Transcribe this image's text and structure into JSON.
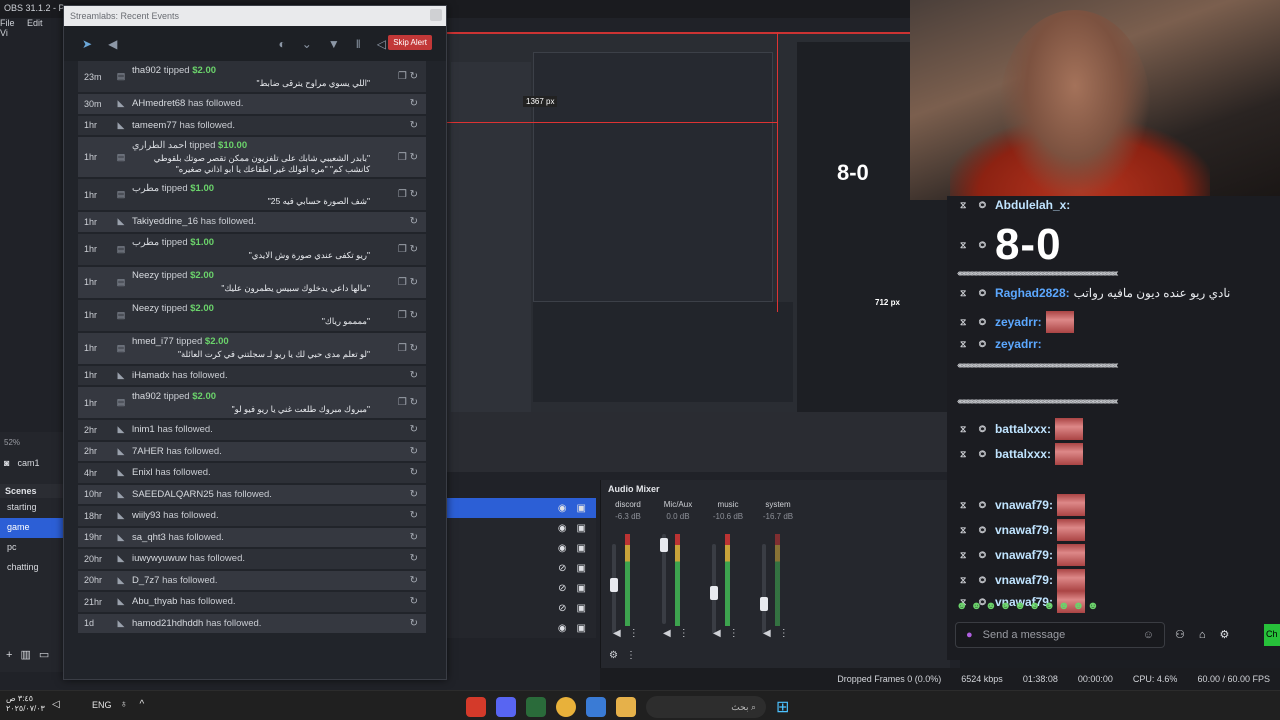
{
  "obs": {
    "title": "OBS 31.1.2 - P",
    "menu": [
      "File",
      "Edit",
      "Vi"
    ],
    "zoom": "52%",
    "cam_label": "cam1",
    "scenes_header": "Scenes",
    "scenes": [
      "starting",
      "game",
      "pc",
      "chatting"
    ],
    "active_scene": "game"
  },
  "events": {
    "title": "Streamlabs: Recent Events",
    "skip_label": "Skip Alert",
    "items": [
      {
        "time": "23m",
        "icon": "tip-icon",
        "name": "tha902",
        "action": "tipped",
        "amount": "$2.00",
        "message": "\"اللي يسوي مراوح يترقى ضابط\""
      },
      {
        "time": "30m",
        "icon": "follow-icon",
        "name": "AHmedret68",
        "action": "has followed.",
        "amount": "",
        "message": ""
      },
      {
        "time": "1hr",
        "icon": "follow-icon",
        "name": "tameem77",
        "action": "has followed.",
        "amount": "",
        "message": ""
      },
      {
        "time": "1hr",
        "icon": "tip-icon",
        "name": "احمد الطراري",
        "action": "tipped",
        "amount": "$10.00",
        "message": "\"بابدر الشعيبي شابك على تلفزيون ممكن تقصر صوتك بلقوطي كانشب كم\" \"مره اقولك غير اطقاعك يا ابو اذاني صغيره\""
      },
      {
        "time": "1hr",
        "icon": "tip-icon",
        "name": "مطرب",
        "action": "tipped",
        "amount": "$1.00",
        "message": "\"شف الصورة حسابي فيه 25\""
      },
      {
        "time": "1hr",
        "icon": "follow-icon",
        "name": "Takiyeddine_16",
        "action": "has followed.",
        "amount": "",
        "message": ""
      },
      {
        "time": "1hr",
        "icon": "tip-icon",
        "name": "مطرب",
        "action": "tipped",
        "amount": "$1.00",
        "message": "\"ريو تكفى عندي صورة وش الايدي\""
      },
      {
        "time": "1hr",
        "icon": "tip-icon",
        "name": "Neezy",
        "action": "tipped",
        "amount": "$2.00",
        "message": "\"مالها داعي يدخلوك سبيس يطمرون عليك\""
      },
      {
        "time": "1hr",
        "icon": "tip-icon",
        "name": "Neezy",
        "action": "tipped",
        "amount": "$2.00",
        "message": "\"ممممو رياك\""
      },
      {
        "time": "1hr",
        "icon": "tip-icon",
        "name": "hmed_i77",
        "action": "tipped",
        "amount": "$2.00",
        "message": "\"لو تعلم مدى حبي لك يا ريو لـ سجلتني في كرت العائلة\""
      },
      {
        "time": "1hr",
        "icon": "follow-icon",
        "name": "iHamadx",
        "action": "has followed.",
        "amount": "",
        "message": ""
      },
      {
        "time": "1hr",
        "icon": "tip-icon",
        "name": "tha902",
        "action": "tipped",
        "amount": "$2.00",
        "message": "\"مبروك مبروك طلعت غني يا ريو فيو لو\""
      },
      {
        "time": "2hr",
        "icon": "follow-icon",
        "name": "lnim1",
        "action": "has followed.",
        "amount": "",
        "message": ""
      },
      {
        "time": "2hr",
        "icon": "follow-icon",
        "name": "7AHER",
        "action": "has followed.",
        "amount": "",
        "message": ""
      },
      {
        "time": "4hr",
        "icon": "follow-icon",
        "name": "Enixl",
        "action": "has followed.",
        "amount": "",
        "message": ""
      },
      {
        "time": "10hr",
        "icon": "follow-icon",
        "name": "SAEEDALQARN25",
        "action": "has followed.",
        "amount": "",
        "message": ""
      },
      {
        "time": "18hr",
        "icon": "follow-icon",
        "name": "wiily93",
        "action": "has followed.",
        "amount": "",
        "message": ""
      },
      {
        "time": "19hr",
        "icon": "follow-icon",
        "name": "sa_qht3",
        "action": "has followed.",
        "amount": "",
        "message": ""
      },
      {
        "time": "20hr",
        "icon": "follow-icon",
        "name": "iuwywyuwuw",
        "action": "has followed.",
        "amount": "",
        "message": ""
      },
      {
        "time": "20hr",
        "icon": "follow-icon",
        "name": "D_7z7",
        "action": "has followed.",
        "amount": "",
        "message": ""
      },
      {
        "time": "21hr",
        "icon": "follow-icon",
        "name": "Abu_thyab",
        "action": "has followed.",
        "amount": "",
        "message": ""
      },
      {
        "time": "1d",
        "icon": "follow-icon",
        "name": "hamod21hdhddh",
        "action": "has followed.",
        "amount": "",
        "message": ""
      }
    ]
  },
  "mixer": {
    "title": "Audio Mixer",
    "channels": [
      {
        "name": "discord",
        "db": "-6.3 dB",
        "level": 0.55
      },
      {
        "name": "Mic/Aux",
        "db": "0.0 dB",
        "level": 0.95
      },
      {
        "name": "music",
        "db": "-10.6 dB",
        "level": 0.45
      },
      {
        "name": "system",
        "db": "-16.7 dB",
        "level": 0.3
      }
    ]
  },
  "preview_labels": {
    "width_readout": "1367 px",
    "height_readout": "712 px",
    "score": "8-0"
  },
  "chat": {
    "rows": [
      {
        "user": "Abdulelah_x:",
        "text": "",
        "emote": false,
        "style": "light"
      },
      {
        "user": "",
        "text": "",
        "emote": false,
        "style": "score"
      },
      {
        "user": "Raghad2828:",
        "text": "نادي ريو عنده ديون مافيه رواتب",
        "emote": false,
        "style": "blue"
      },
      {
        "user": "zeyadrr:",
        "text": "",
        "emote": true,
        "style": "blue"
      },
      {
        "user": "zeyadrr:",
        "text": "",
        "emote": false,
        "style": "blue"
      },
      {
        "user": "battalxxx:",
        "text": "",
        "emote": true,
        "style": "light"
      },
      {
        "user": "battalxxx:",
        "text": "",
        "emote": true,
        "style": "light"
      },
      {
        "user": "vnawaf79:",
        "text": "",
        "emote": true,
        "style": "light"
      },
      {
        "user": "vnawaf79:",
        "text": "",
        "emote": true,
        "style": "light"
      },
      {
        "user": "vnawaf79:",
        "text": "",
        "emote": true,
        "style": "light"
      },
      {
        "user": "vnawaf79:",
        "text": "",
        "emote": true,
        "style": "light"
      },
      {
        "user": "vnawaf79:",
        "text": "",
        "emote": true,
        "style": "light"
      }
    ],
    "placeholder": "Send a message",
    "send_label": "Ch"
  },
  "status": {
    "dropped": "Dropped Frames 0 (0.0%)",
    "bitrate": "6524 kbps",
    "rec_time": "01:38:08",
    "stream_time": "00:00:00",
    "cpu": "CPU: 4.6%",
    "fps": "60.00 / 60.00 FPS"
  },
  "taskbar": {
    "time": "٣:٤٥ ص",
    "date": "٢٠٢٥/٠٧/٠٣",
    "lang": "ENG",
    "search": "بحث"
  }
}
